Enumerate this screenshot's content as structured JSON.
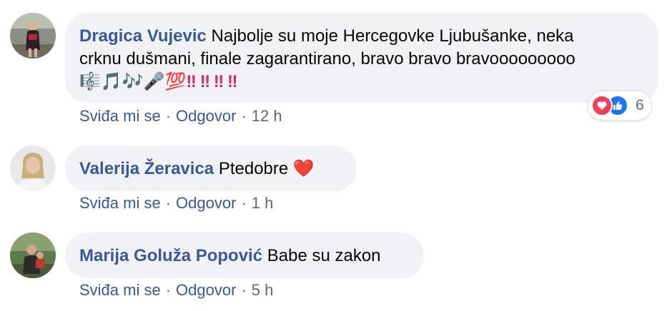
{
  "comments": [
    {
      "author": "Dragica Vujevic",
      "text_line1": "Najbolje su moje Hercegovke Ljubušanke, neka",
      "text_line2": "crknu dušmani, finale zagarantirano, bravo bravo bravooooooooo",
      "emoji_line": "🎼🎵🎶🎤💯",
      "exclaims": [
        "‼",
        "‼",
        "‼",
        "‼"
      ],
      "like_label": "Sviđa mi se",
      "reply_label": "Odgovor",
      "time": "12 h",
      "reaction_count": "6"
    },
    {
      "author": "Valerija Žeravica",
      "text": "Ptedobre",
      "emoji": "❤️",
      "like_label": "Sviđa mi se",
      "reply_label": "Odgovor",
      "time": "1 h"
    },
    {
      "author": "Marija Goluža Popović",
      "text": "Babe su zakon",
      "like_label": "Sviđa mi se",
      "reply_label": "Odgovor",
      "time": "5 h"
    }
  ],
  "separator": "·",
  "colors": {
    "author": "#385898",
    "bubble": "#f0f2f5",
    "meta": "#65676b",
    "love": "#f33e58",
    "like": "#1877f2"
  },
  "icons": [
    "love-reaction-icon",
    "like-reaction-icon"
  ]
}
